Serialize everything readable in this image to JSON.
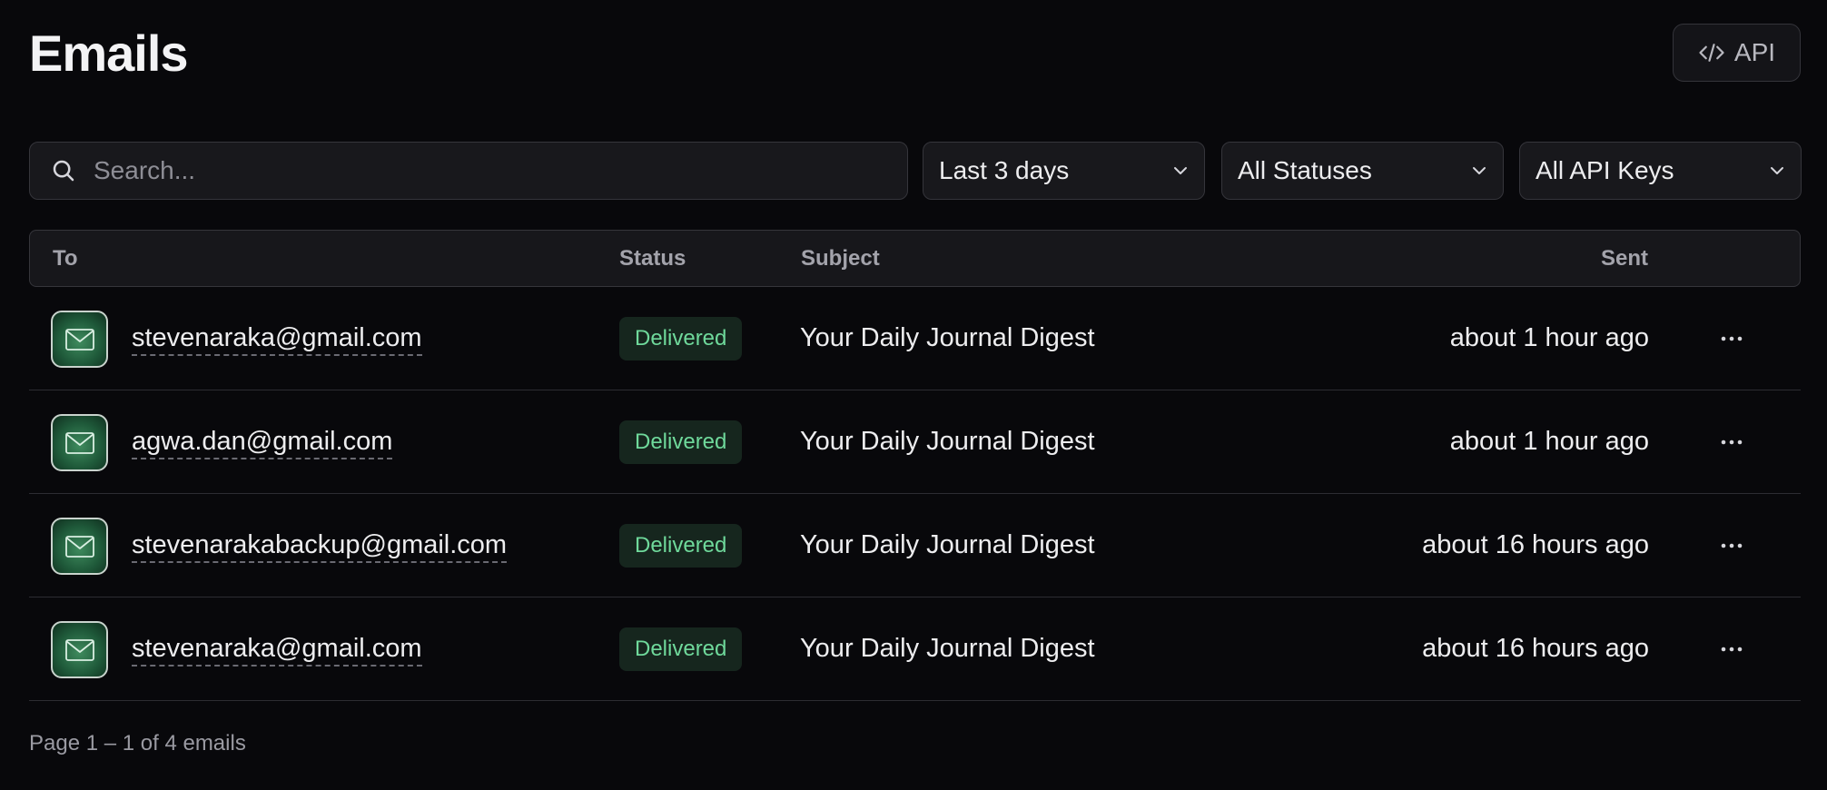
{
  "header": {
    "title": "Emails",
    "api_label": "API"
  },
  "filters": {
    "search_placeholder": "Search...",
    "date_range": "Last 3 days",
    "status": "All Statuses",
    "api_keys": "All API Keys"
  },
  "table": {
    "columns": {
      "to": "To",
      "status": "Status",
      "subject": "Subject",
      "sent": "Sent"
    },
    "rows": [
      {
        "to": "stevenaraka@gmail.com",
        "status": "Delivered",
        "subject": "Your Daily Journal Digest",
        "sent": "about 1 hour ago"
      },
      {
        "to": "agwa.dan@gmail.com",
        "status": "Delivered",
        "subject": "Your Daily Journal Digest",
        "sent": "about 1 hour ago"
      },
      {
        "to": "stevenarakabackup@gmail.com",
        "status": "Delivered",
        "subject": "Your Daily Journal Digest",
        "sent": "about 16 hours ago"
      },
      {
        "to": "stevenaraka@gmail.com",
        "status": "Delivered",
        "subject": "Your Daily Journal Digest",
        "sent": "about 16 hours ago"
      }
    ]
  },
  "pagination": {
    "summary": "Page 1 – 1 of 4 emails"
  },
  "icons": {
    "api": "code-icon",
    "search": "search-icon",
    "dropdown": "chevron-down-icon",
    "avatar": "mail-icon",
    "row_actions": "more-horizontal-icon"
  },
  "colors": {
    "background": "#08080b",
    "delivered_text": "#6fd99b",
    "delivered_bg": "#16261e",
    "avatar_green": "#2f7a50"
  }
}
